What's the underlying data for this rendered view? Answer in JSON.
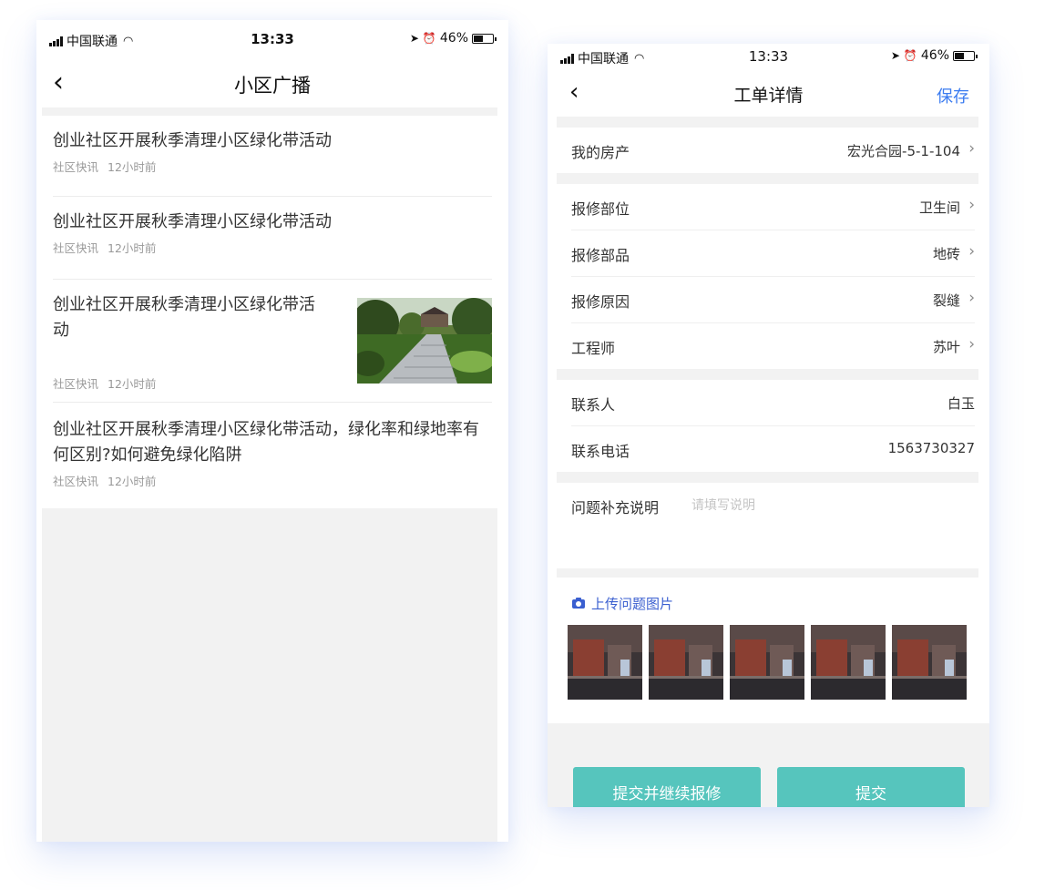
{
  "left_phone": {
    "status": {
      "carrier": "中国联通",
      "time": "13:33",
      "battery": "46%"
    },
    "nav": {
      "back": "‹",
      "title": "小区广播"
    },
    "news": [
      {
        "title": "创业社区开展秋季清理小区绿化带活动",
        "source": "社区快讯",
        "time": "12小时前"
      },
      {
        "title": "创业社区开展秋季清理小区绿化带活动",
        "source": "社区快讯",
        "time": "12小时前"
      },
      {
        "title": "创业社区开展秋季清理小区绿化带活动",
        "source": "社区快讯",
        "time": "12小时前",
        "has_image": true
      },
      {
        "title": "创业社区开展秋季清理小区绿化带活动，绿化率和绿地率有何区别?如何避免绿化陷阱",
        "source": "社区快讯",
        "time": "12小时前"
      }
    ]
  },
  "right_phone": {
    "status": {
      "carrier": "中国联通",
      "time": "13:33",
      "battery": "46%"
    },
    "nav": {
      "back": "‹",
      "title": "工单详情",
      "save": "保存"
    },
    "property": {
      "label": "我的房产",
      "value": "宏光合园-5-1-104"
    },
    "repair_rows": [
      {
        "label": "报修部位",
        "value": "卫生间"
      },
      {
        "label": "报修部品",
        "value": "地砖"
      },
      {
        "label": "报修原因",
        "value": "裂缝"
      },
      {
        "label": "工程师",
        "value": "苏叶"
      }
    ],
    "contact_rows": [
      {
        "label": "联系人",
        "value": "白玉"
      },
      {
        "label": "联系电话",
        "value": "1563730327"
      }
    ],
    "remark": {
      "label": "问题补充说明",
      "placeholder": "请填写说明"
    },
    "upload": {
      "label": "上传问题图片",
      "photo_count": 5
    },
    "buttons": {
      "submit_continue": "提交并继续报修",
      "submit": "提交"
    },
    "colors": {
      "accent": "#3a7bf0",
      "button": "#56c5bd",
      "upload_label": "#3a5fd0"
    }
  }
}
